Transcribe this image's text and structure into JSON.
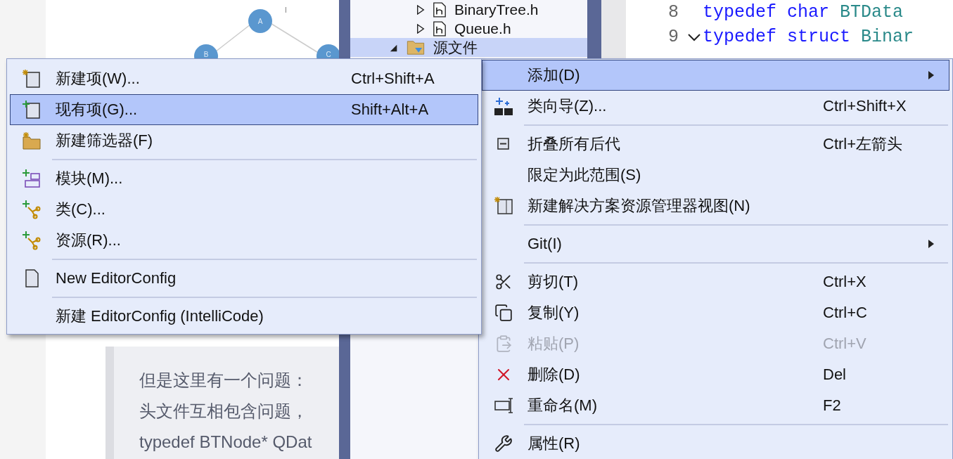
{
  "blog": {
    "diagram_nodes": [
      {
        "label": "A"
      },
      {
        "label": "B"
      },
      {
        "label": "C"
      }
    ],
    "cursor_mark": "I",
    "quote_lines": [
      "但是这里有一个问题：",
      "头文件互相包含问题，",
      "typedef BTNode* QDat"
    ]
  },
  "solution_explorer": {
    "items": [
      {
        "label": "BinaryTree.h",
        "kind": "header",
        "expanded": false,
        "selected": false
      },
      {
        "label": "Queue.h",
        "kind": "header",
        "expanded": false,
        "selected": false
      },
      {
        "label": "源文件",
        "kind": "folder",
        "expanded": true,
        "selected": true
      }
    ]
  },
  "editor": {
    "lines": [
      {
        "number": "8",
        "segments": [
          {
            "text": "typedef char ",
            "kind": "keyword"
          },
          {
            "text": "BTData",
            "kind": "type"
          }
        ]
      },
      {
        "number": "9",
        "expanded": true,
        "segments": [
          {
            "text": "typedef struct ",
            "kind": "keyword"
          },
          {
            "text": "Binar",
            "kind": "type"
          }
        ]
      }
    ]
  },
  "submenu": {
    "items": [
      {
        "kind": "item",
        "label": "新建项(W)...",
        "shortcut": "Ctrl+Shift+A",
        "selected": false
      },
      {
        "kind": "item",
        "label": "现有项(G)...",
        "shortcut": "Shift+Alt+A",
        "selected": true
      },
      {
        "kind": "item",
        "label": "新建筛选器(F)",
        "selected": false
      },
      {
        "kind": "separator"
      },
      {
        "kind": "item",
        "label": "模块(M)...",
        "selected": false
      },
      {
        "kind": "item",
        "label": "类(C)...",
        "selected": false
      },
      {
        "kind": "item",
        "label": "资源(R)...",
        "selected": false
      },
      {
        "kind": "separator"
      },
      {
        "kind": "item",
        "label": "New EditorConfig",
        "selected": false
      },
      {
        "kind": "separator"
      },
      {
        "kind": "item",
        "label": "新建 EditorConfig (IntelliCode)",
        "selected": false
      }
    ]
  },
  "context_menu": {
    "items": [
      {
        "kind": "item",
        "label": "添加(D)",
        "has_submenu": true,
        "selected": true,
        "disabled": false
      },
      {
        "kind": "item",
        "label": "类向导(Z)...",
        "shortcut": "Ctrl+Shift+X",
        "selected": false,
        "disabled": false
      },
      {
        "kind": "separator"
      },
      {
        "kind": "item",
        "label": "折叠所有后代",
        "shortcut": "Ctrl+左箭头",
        "selected": false,
        "disabled": false
      },
      {
        "kind": "item",
        "label": "限定为此范围(S)",
        "selected": false,
        "disabled": false
      },
      {
        "kind": "item",
        "label": "新建解决方案资源管理器视图(N)",
        "selected": false,
        "disabled": false
      },
      {
        "kind": "separator"
      },
      {
        "kind": "item",
        "label": "Git(I)",
        "has_submenu": true,
        "selected": false,
        "disabled": false
      },
      {
        "kind": "separator"
      },
      {
        "kind": "item",
        "label": "剪切(T)",
        "shortcut": "Ctrl+X",
        "selected": false,
        "disabled": false
      },
      {
        "kind": "item",
        "label": "复制(Y)",
        "shortcut": "Ctrl+C",
        "selected": false,
        "disabled": false
      },
      {
        "kind": "item",
        "label": "粘贴(P)",
        "shortcut": "Ctrl+V",
        "selected": false,
        "disabled": true
      },
      {
        "kind": "item",
        "label": "删除(D)",
        "shortcut": "Del",
        "selected": false,
        "disabled": false
      },
      {
        "kind": "item",
        "label": "重命名(M)",
        "shortcut": "F2",
        "selected": false,
        "disabled": false
      },
      {
        "kind": "separator"
      },
      {
        "kind": "item",
        "label": "属性(R)",
        "selected": false,
        "disabled": false
      }
    ]
  }
}
